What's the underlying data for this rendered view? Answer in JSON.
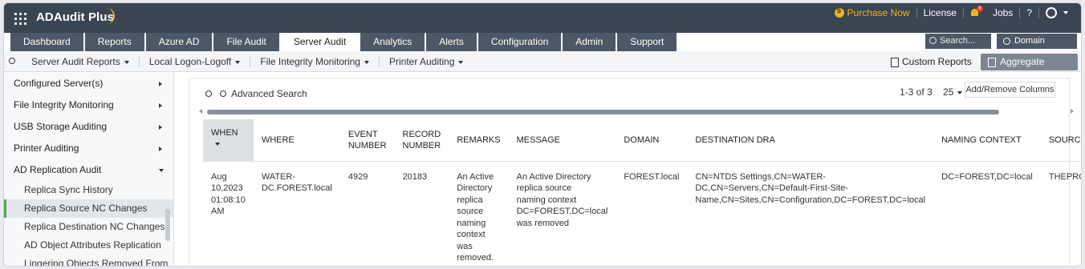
{
  "app": {
    "title": "ADAudit Plus"
  },
  "top_right": {
    "purchase": "Purchase Now",
    "license": "License",
    "jobs": "Jobs",
    "help": "?",
    "notif_count": "8"
  },
  "tabs": [
    {
      "label": "Dashboard"
    },
    {
      "label": "Reports"
    },
    {
      "label": "Azure AD"
    },
    {
      "label": "File Audit"
    },
    {
      "label": "Server Audit"
    },
    {
      "label": "Analytics"
    },
    {
      "label": "Alerts"
    },
    {
      "label": "Configuration"
    },
    {
      "label": "Admin"
    },
    {
      "label": "Support"
    }
  ],
  "search": {
    "placeholder": "Search..."
  },
  "domain_settings": "Domain Settings",
  "subnav": {
    "items": [
      "Server Audit Reports",
      "Local Logon-Logoff",
      "File Integrity Monitoring",
      "Printer Auditing"
    ],
    "custom_reports": "Custom Reports",
    "aggregate_reports": "Aggregate Reports"
  },
  "sidebar": {
    "categories": [
      {
        "label": "Configured Server(s)"
      },
      {
        "label": "File Integrity Monitoring"
      },
      {
        "label": "USB Storage Auditing"
      },
      {
        "label": "Printer Auditing"
      },
      {
        "label": "AD Replication Audit"
      }
    ],
    "sub_items": [
      {
        "label": "Replica Sync History"
      },
      {
        "label": "Replica Source NC Changes"
      },
      {
        "label": "Replica Destination NC Changes"
      },
      {
        "label": "AD Object Attributes Replication"
      },
      {
        "label": "Lingering Objects Removed From"
      }
    ]
  },
  "toolbar": {
    "advanced_search": "Advanced Search",
    "pagination": "1-3 of 3",
    "page_size": "25",
    "add_remove_columns": "Add/Remove Columns"
  },
  "table": {
    "headers": {
      "when": "WHEN",
      "where": "WHERE",
      "event1": "EVENT",
      "event2": "NUMBER",
      "record1": "RECORD",
      "record2": "NUMBER",
      "remarks": "REMARKS",
      "message": "MESSAGE",
      "domain": "DOMAIN",
      "dest_dra": "DESTINATION DRA",
      "naming_context": "NAMING CONTEXT",
      "source_address": "SOURCE ADDRESS"
    },
    "rows": [
      {
        "when": [
          "Aug",
          "10,2023",
          "01:08:10",
          "AM"
        ],
        "where": [
          "WATER-",
          "DC.FOREST.local"
        ],
        "event_number": "4929",
        "record_number": "20183",
        "remarks": [
          "An Active",
          "Directory",
          "replica",
          "source",
          "naming",
          "context",
          "was",
          "removed."
        ],
        "message": [
          "An Active Directory",
          "replica source",
          "naming context",
          "DC=FOREST,DC=local",
          "was removed"
        ],
        "domain": "FOREST.local",
        "dest_dra": [
          "CN=NTDS Settings,CN=WATER-",
          "DC,CN=Servers,CN=Default-First-Site-",
          "Name,CN=Sites,CN=Configuration,DC=FOREST,DC=local"
        ],
        "naming_context": "DC=FOREST,DC=local",
        "source_address": "THEPROFESSOR.FOR"
      }
    ]
  }
}
